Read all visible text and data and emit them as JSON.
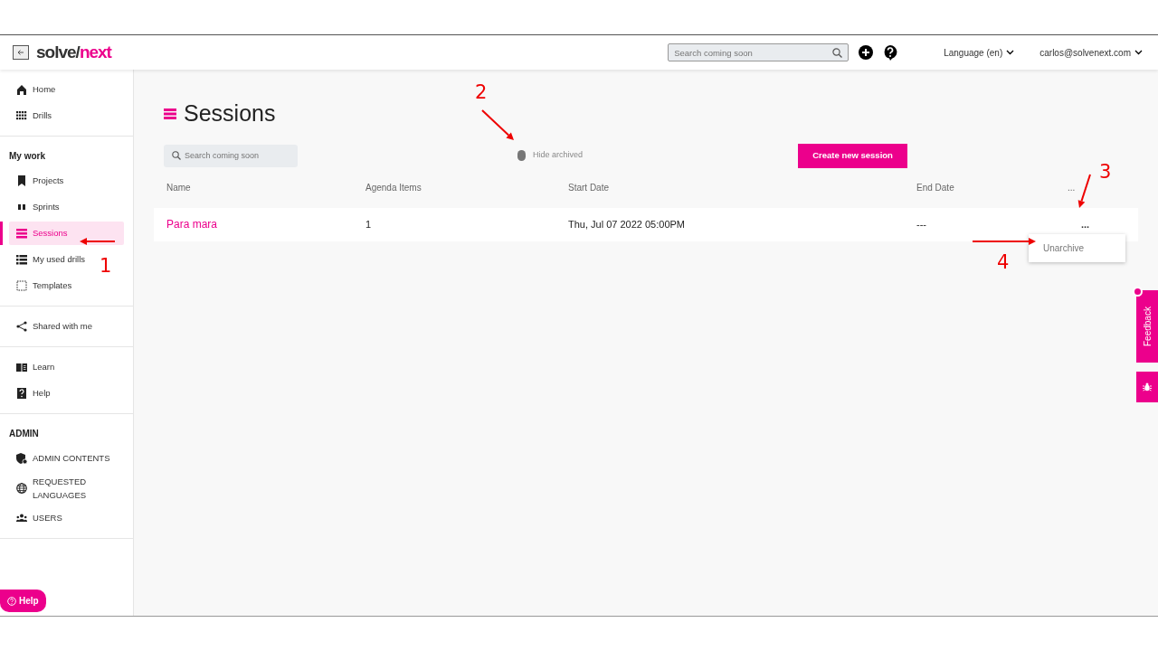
{
  "topbar": {
    "logo_left": "solve/",
    "logo_right": "next",
    "search": {
      "placeholder": "Search coming soon"
    },
    "language": "Language (en)",
    "user": "carlos@solvenext.com"
  },
  "sidebar": {
    "groups": [
      {
        "items": [
          {
            "label": "Home",
            "selected": false
          },
          {
            "label": "Drills",
            "selected": false
          }
        ]
      },
      {
        "heading": "My work",
        "items": [
          {
            "label": "Projects",
            "selected": false
          },
          {
            "label": "Sprints",
            "selected": false
          },
          {
            "label": "Sessions",
            "selected": true
          },
          {
            "label": "My used drills",
            "selected": false
          },
          {
            "label": "Templates",
            "selected": false
          }
        ]
      },
      {
        "items": [
          {
            "label": "Shared with me",
            "selected": false
          }
        ]
      },
      {
        "items": [
          {
            "label": "Learn",
            "selected": false
          },
          {
            "label": "Help",
            "selected": false
          }
        ]
      },
      {
        "heading": "ADMIN",
        "items": [
          {
            "label": "ADMIN CONTENTS",
            "selected": false
          },
          {
            "label": "REQUESTED LANGUAGES",
            "selected": false
          },
          {
            "label": "USERS",
            "selected": false
          }
        ]
      }
    ],
    "help_button": "Help"
  },
  "page": {
    "title": "Sessions",
    "search": {
      "placeholder": "Search coming soon"
    },
    "toggle": {
      "label": "Hide archived",
      "on": false
    },
    "create_button": "Create new session"
  },
  "table": {
    "columns": [
      "Name",
      "Agenda Items",
      "Start Date",
      "End Date",
      "..."
    ],
    "rows": [
      {
        "name": "Para mara",
        "agenda_items": "1",
        "start_date": "Thu, Jul 07 2022 05:00PM",
        "end_date": "---",
        "menu": "...",
        "menu_open": true,
        "menu_items": [
          "Unarchive"
        ]
      }
    ]
  },
  "feedback": {
    "label": "Feedback"
  },
  "annotations": [
    {
      "label": "1"
    },
    {
      "label": "2"
    },
    {
      "label": "3"
    },
    {
      "label": "4"
    }
  ]
}
